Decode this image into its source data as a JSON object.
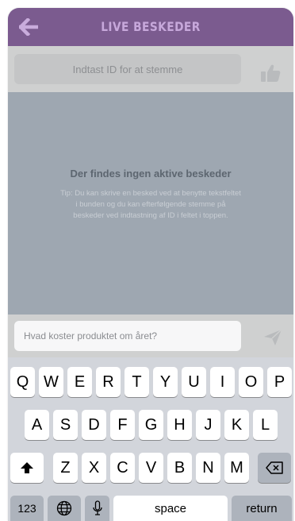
{
  "header": {
    "title": "LIVE BESKEDER",
    "back_icon": "arrow-left-icon",
    "background": "#7b5b8f"
  },
  "vote": {
    "placeholder": "Indtast ID for at stemme",
    "button_icon": "thumbs-up-icon"
  },
  "messages": {
    "empty_title": "Der findes ingen aktive beskeder",
    "empty_tip": "Tip: Du kan skrive en besked ved at benytte tekstfeltet i bunden og du kan efterfølgende stemme på beskeder ved indtastning af ID i feltet i toppen."
  },
  "compose": {
    "value": "Hvad koster produktet om året?",
    "send_icon": "paper-plane-icon"
  },
  "keyboard": {
    "row1": [
      "Q",
      "W",
      "E",
      "R",
      "T",
      "Y",
      "U",
      "I",
      "O",
      "P"
    ],
    "row2": [
      "A",
      "S",
      "D",
      "F",
      "G",
      "H",
      "J",
      "K",
      "L"
    ],
    "row3": [
      "Z",
      "X",
      "C",
      "V",
      "B",
      "N",
      "M"
    ],
    "shift_icon": "shift-arrow-icon",
    "delete_icon": "backspace-icon",
    "numbers_label": "123",
    "globe_icon": "globe-icon",
    "mic_icon": "microphone-icon",
    "space_label": "space",
    "return_label": "return"
  }
}
